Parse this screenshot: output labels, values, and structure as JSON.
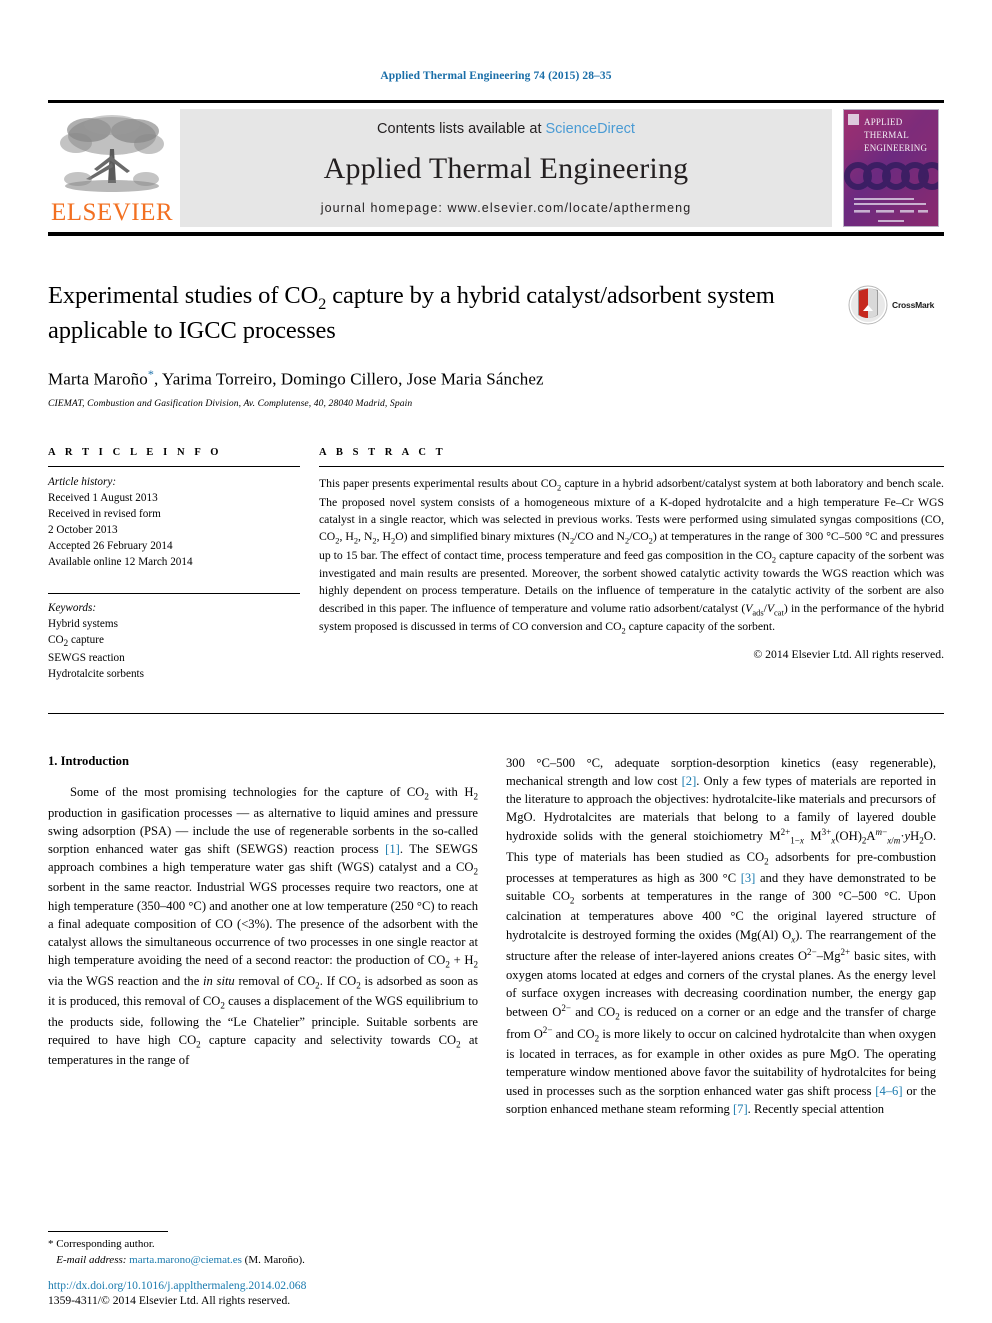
{
  "running_head": "Applied Thermal Engineering 74 (2015) 28–35",
  "masthead": {
    "publisher": "ELSEVIER",
    "contents_prefix": "Contents lists available at ",
    "contents_link": "ScienceDirect",
    "journal_title": "Applied Thermal Engineering",
    "homepage": "journal homepage: www.elsevier.com/locate/apthermeng",
    "cover_lines": [
      "APPLIED",
      "THERMAL",
      "ENGINEERING"
    ],
    "cover_colors": {
      "top": "#8e2f6e",
      "mid": "#5b2a7a",
      "bottom": "#7a2a6a"
    }
  },
  "article": {
    "title_part1": "Experimental studies of CO",
    "title_sub1": "2",
    "title_part2": " capture by a hybrid catalyst/adsorbent system applicable to IGCC processes",
    "crossmark_label": "CrossMark",
    "authors": "Marta Maroño",
    "authors_rest": ", Yarima Torreiro, Domingo Cillero, Jose Maria Sánchez",
    "affiliation": "CIEMAT, Combustion and Gasification Division, Av. Complutense, 40, 28040 Madrid, Spain"
  },
  "info": {
    "heading": "A R T I C L E   I N F O",
    "history_label": "Article history:",
    "history": [
      "Received 1 August 2013",
      "Received in revised form",
      "2 October 2013",
      "Accepted 26 February 2014",
      "Available online 12 March 2014"
    ],
    "keywords_label": "Keywords:",
    "keywords": [
      "Hybrid systems",
      "CO2 capture",
      "SEWGS reaction",
      "Hydrotalcite sorbents"
    ]
  },
  "abstract": {
    "heading": "A B S T R A C T",
    "text": "This paper presents experimental results about CO2 capture in a hybrid adsorbent/catalyst system at both laboratory and bench scale. The proposed novel system consists of a homogeneous mixture of a K-doped hydrotalcite and a high temperature Fe–Cr WGS catalyst in a single reactor, which was selected in previous works. Tests were performed using simulated syngas compositions (CO, CO2, H2, N2, H2O) and simplified binary mixtures (N2/CO and N2/CO2) at temperatures in the range of 300 °C–500 °C and pressures up to 15 bar. The effect of contact time, process temperature and feed gas composition in the CO2 capture capacity of the sorbent was investigated and main results are presented. Moreover, the sorbent showed catalytic activity towards the WGS reaction which was highly dependent on process temperature. Details on the influence of temperature in the catalytic activity of the sorbent are also described in this paper. The influence of temperature and volume ratio adsorbent/catalyst (Vads/Vcat) in the performance of the hybrid system proposed is discussed in terms of CO conversion and CO2 capture capacity of the sorbent.",
    "copyright": "© 2014 Elsevier Ltd. All rights reserved."
  },
  "body": {
    "section_number_title": "1.  Introduction",
    "left_paragraph": "Some of the most promising technologies for the capture of CO2 with H2 production in gasification processes — as alternative to liquid amines and pressure swing adsorption (PSA) — include the use of regenerable sorbents in the so-called sorption enhanced water gas shift (SEWGS) reaction process [1]. The SEWGS approach combines a high temperature water gas shift (WGS) catalyst and a CO2 sorbent in the same reactor. Industrial WGS processes require two reactors, one at high temperature (350–400 °C) and another one at low temperature (250 °C) to reach a final adequate composition of CO (<3%). The presence of the adsorbent with the catalyst allows the simultaneous occurrence of two processes in one single reactor at high temperature avoiding the need of a second reactor: the production of CO2 + H2 via the WGS reaction and the in situ removal of CO2. If CO2 is adsorbed as soon as it is produced, this removal of CO2 causes a displacement of the WGS equilibrium to the products side, following the “Le Chatelier” principle. Suitable sorbents are required to have high CO2 capture capacity and selectivity towards CO2 at temperatures in the range of",
    "right_paragraph": "300 °C–500 °C, adequate sorption-desorption kinetics (easy regenerable), mechanical strength and low cost [2]. Only a few types of materials are reported in the literature to approach the objectives: hydrotalcite-like materials and precursors of MgO. Hydrotalcites are materials that belong to a family of layered double hydroxide solids with the general stoichiometry M2+1−x M3+x(OH)2Am−x/m·yH2O. This type of materials has been studied as CO2 adsorbents for pre-combustion processes at temperatures as high as 300 °C [3] and they have demonstrated to be suitable CO2 sorbents at temperatures in the range of 300 °C–500 °C. Upon calcination at temperatures above 400 °C the original layered structure of hydrotalcite is destroyed forming the oxides (Mg(Al)Ox). The rearrangement of the structure after the release of inter-layered anions creates O2−–Mg2+ basic sites, with oxygen atoms located at edges and corners of the crystal planes. As the energy level of surface oxygen increases with decreasing coordination number, the energy gap between O2− and CO2 is reduced on a corner or an edge and the transfer of charge from O2− and CO2 is more likely to occur on calcined hydrotalcite than when oxygen is located in terraces, as for example in other oxides as pure MgO. The operating temperature window mentioned above favor the suitability of hydrotalcites for being used in processes such as the sorption enhanced water gas shift process [4–6] or the sorption enhanced methane steam reforming [7]. Recently special attention"
  },
  "footnote": {
    "corresponding": "* Corresponding author.",
    "email_label": "E-mail address:",
    "email": "marta.marono@ciemat.es",
    "email_suffix": " (M. Maroño)."
  },
  "colophon": {
    "doi": "http://dx.doi.org/10.1016/j.applthermaleng.2014.02.068",
    "issn": "1359-4311/© 2014 Elsevier Ltd. All rights reserved."
  },
  "colors": {
    "link": "#1a7aae",
    "elsevier_orange": "#F27021",
    "sciencedirect_blue": "#4a9bd4",
    "running_head_blue": "#1a6ea8"
  }
}
